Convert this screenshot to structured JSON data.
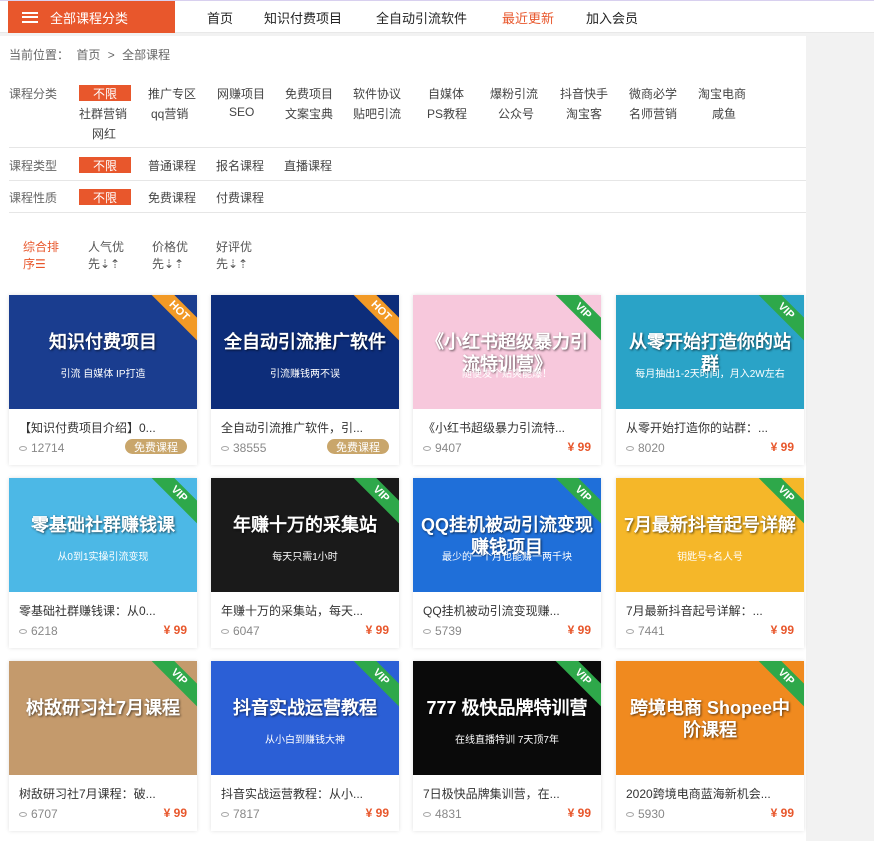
{
  "header": {
    "all_categories": "全部课程分类",
    "nav": [
      "首页",
      "知识付费项目",
      "全自动引流软件",
      "最近更新",
      "加入会员"
    ]
  },
  "breadcrumb": {
    "prefix": "当前位置：",
    "home": "首页",
    "sep": ">",
    "current": "全部课程"
  },
  "filters": {
    "category": {
      "label": "课程分类",
      "selected": "不限",
      "options": [
        "推广专区",
        "网赚项目",
        "免费项目",
        "软件协议",
        "自媒体",
        "爆粉引流",
        "抖音快手",
        "微商必学",
        "淘宝电商",
        "社群营销",
        "qq营销",
        "SEO",
        "文案宝典",
        "贴吧引流",
        "PS教程",
        "公众号",
        "淘宝客",
        "名师营销",
        "咸鱼",
        "网红"
      ]
    },
    "type": {
      "label": "课程类型",
      "selected": "不限",
      "options": [
        "普通课程",
        "报名课程",
        "直播课程"
      ]
    },
    "nature": {
      "label": "课程性质",
      "selected": "不限",
      "options": [
        "免费课程",
        "付费课程"
      ]
    }
  },
  "sort": [
    {
      "line1": "综合排",
      "line2": "序☰"
    },
    {
      "line1": "人气优",
      "line2": "先⇣⇡"
    },
    {
      "line1": "价格优",
      "line2": "先⇣⇡"
    },
    {
      "line1": "好评优",
      "line2": "先⇣⇡"
    }
  ],
  "courses": [
    {
      "thumb_text": "知识付费项目",
      "thumb_sub": "引流 自媒体 IP打造",
      "ribbon": "HOT",
      "bg": "#1a3d8f",
      "title": "【知识付费项目介绍】0...",
      "views": "12714",
      "badge": "免费课程"
    },
    {
      "thumb_text": "全自动引流推广软件",
      "thumb_sub": "引流赚钱两不误",
      "ribbon": "HOT",
      "bg": "#0d2d7a",
      "title": "全自动引流推广软件，引...",
      "views": "38555",
      "badge": "免费课程"
    },
    {
      "thumb_text": "《小红书超级暴力引流特训营》",
      "thumb_sub": "随便发个贴爽能爆！",
      "ribbon": "VIP",
      "bg": "#f7c8dc",
      "title": "《小红书超级暴力引流特...",
      "views": "9407",
      "price": "¥ 99"
    },
    {
      "thumb_text": "从零开始打造你的站群",
      "thumb_sub": "每月抽出1-2天时间，月入2W左右",
      "ribbon": "VIP",
      "bg": "#2aa3c7",
      "title": "从零开始打造你的站群：...",
      "views": "8020",
      "price": "¥ 99"
    },
    {
      "thumb_text": "零基础社群赚钱课",
      "thumb_sub": "从0到1实操引流变现",
      "ribbon": "VIP",
      "bg": "#4cb8e6",
      "title": "零基础社群赚钱课：从0...",
      "views": "6218",
      "price": "¥ 99"
    },
    {
      "thumb_text": "年赚十万的采集站",
      "thumb_sub": "每天只需1小时",
      "ribbon": "VIP",
      "bg": "#1a1a1a",
      "title": "年赚十万的采集站，每天...",
      "views": "6047",
      "price": "¥ 99"
    },
    {
      "thumb_text": "QQ挂机被动引流变现赚钱项目",
      "thumb_sub": "最少的一个月也能赚一两千块",
      "ribbon": "VIP",
      "bg": "#1f6fd9",
      "title": "QQ挂机被动引流变现赚...",
      "views": "5739",
      "price": "¥ 99"
    },
    {
      "thumb_text": "7月最新抖音起号详解",
      "thumb_sub": "钥匙号+名人号",
      "ribbon": "VIP",
      "bg": "#f5b729",
      "title": "7月最新抖音起号详解：...",
      "views": "7441",
      "price": "¥ 99"
    },
    {
      "thumb_text": "树敌研习社7月课程",
      "thumb_sub": "",
      "ribbon": "VIP",
      "bg": "#c49a6c",
      "title": "树敌研习社7月课程：破...",
      "views": "6707",
      "price": "¥ 99"
    },
    {
      "thumb_text": "抖音实战运营教程",
      "thumb_sub": "从小白到赚钱大神",
      "ribbon": "VIP",
      "bg": "#2b5fd6",
      "title": "抖音实战运营教程：从小...",
      "views": "7817",
      "price": "¥ 99"
    },
    {
      "thumb_text": "777 极快品牌特训营",
      "thumb_sub": "在线直播特训 7天顶7年",
      "ribbon": "VIP",
      "bg": "#0a0a0a",
      "title": "7日极快品牌集训营，在...",
      "views": "4831",
      "price": "¥ 99"
    },
    {
      "thumb_text": "跨境电商 Shopee中阶课程",
      "thumb_sub": "",
      "ribbon": "VIP",
      "bg": "#f08a1f",
      "title": "2020跨境电商蓝海新机会...",
      "views": "5930",
      "price": "¥ 99"
    }
  ],
  "colors": {
    "accent": "#e8572c",
    "hot": "#f29a26",
    "vip": "#2ea84a"
  }
}
